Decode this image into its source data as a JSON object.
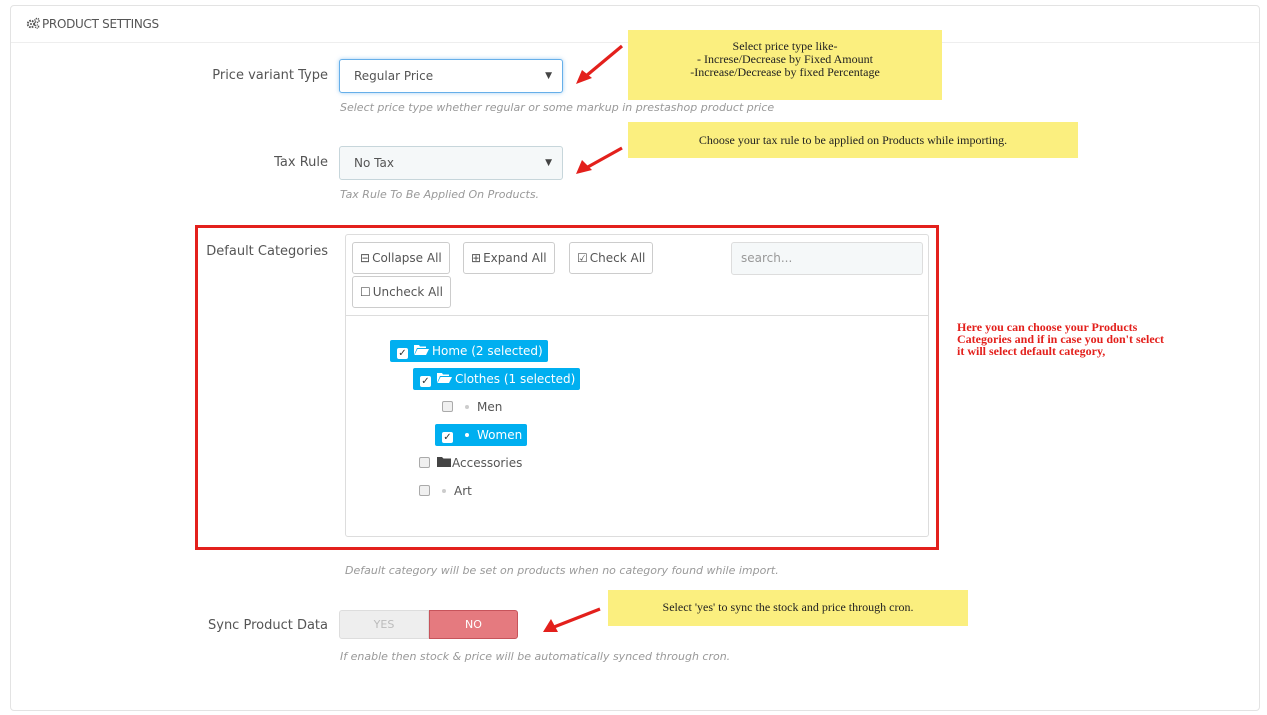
{
  "panel": {
    "title": "PRODUCT SETTINGS",
    "icon": "gears-icon"
  },
  "price_variant": {
    "label": "Price variant Type",
    "value": "Regular Price",
    "help": "Select price type whether regular or some markup in prestashop product price",
    "note_lines": [
      "Select price type like-",
      "- Increse/Decrease by Fixed Amount",
      "-Increase/Decrease by fixed Percentage"
    ]
  },
  "tax_rule": {
    "label": "Tax Rule",
    "value": "No Tax",
    "help": "Tax Rule To Be Applied On Products.",
    "note": "Choose your tax rule to be applied on Products while importing."
  },
  "categories": {
    "label": "Default Categories",
    "buttons": {
      "collapse": "Collapse All",
      "expand": "Expand All",
      "check": "Check All",
      "uncheck": "Uncheck All"
    },
    "search_placeholder": "search...",
    "tree": {
      "home": "Home (2 selected)",
      "clothes": "Clothes (1 selected)",
      "men": "Men",
      "women": "Women",
      "accessories": "Accessories",
      "art": "Art"
    },
    "help": "Default category will be set on products when no category found while import.",
    "note_lines": [
      "Here you can choose your Products",
      "Categories and if in case you don't select",
      "it will select default category,"
    ]
  },
  "sync": {
    "label": "Sync Product Data",
    "yes": "YES",
    "no": "NO",
    "selected": "NO",
    "help": "If enable then stock & price will be automatically synced through cron.",
    "note": "Select 'yes' to sync the stock and price through cron."
  },
  "colors": {
    "accent": "#00aff0",
    "annotation_red": "#e3201c",
    "note_yellow": "#fbef7f",
    "no_active": "#e57a7f"
  }
}
